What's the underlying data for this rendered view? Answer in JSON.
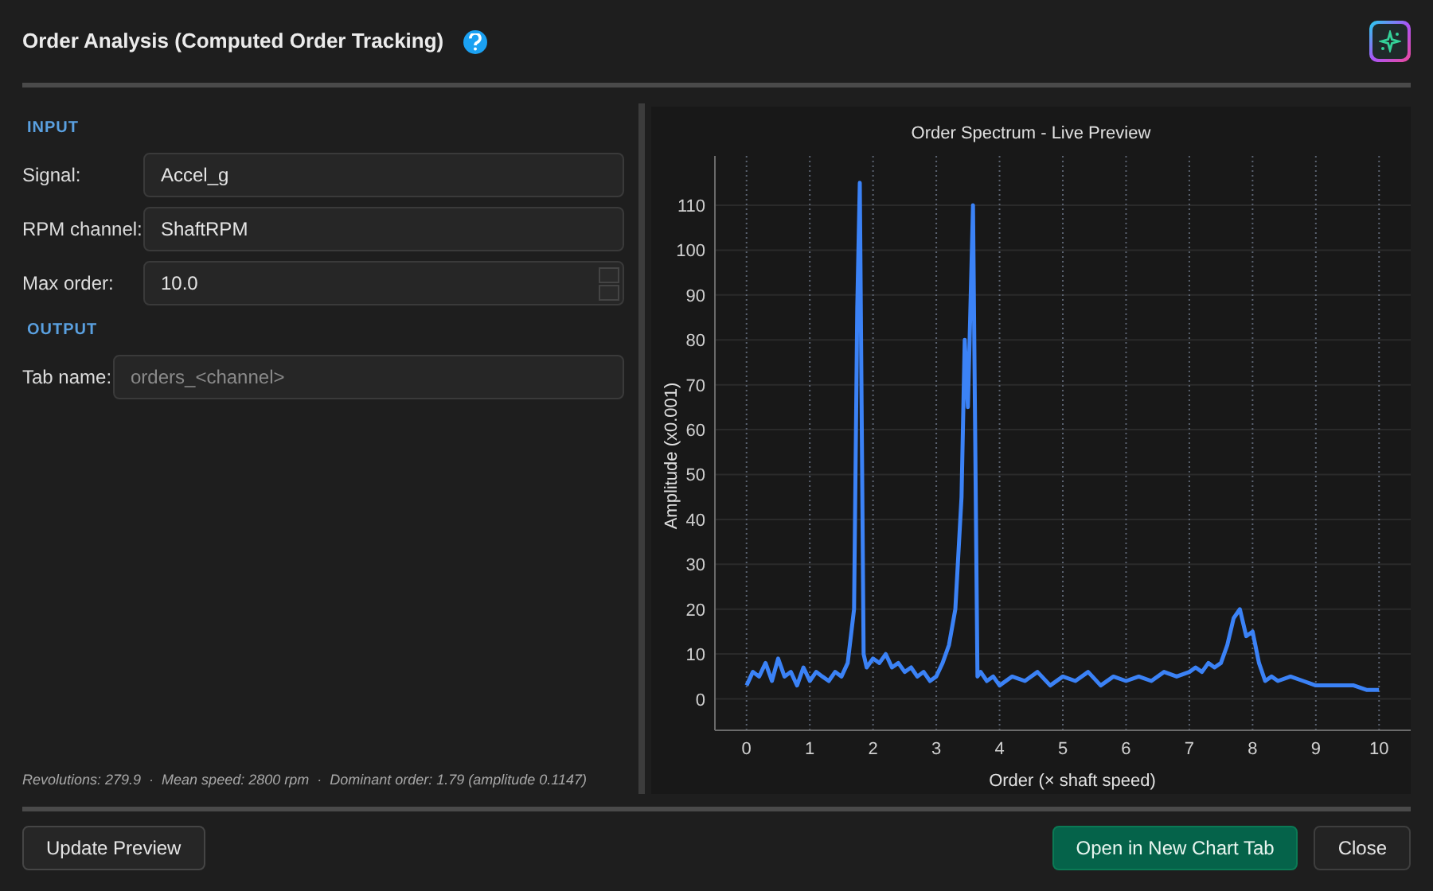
{
  "window": {
    "title": "Order Analysis (Computed Order Tracking)"
  },
  "input": {
    "heading": "INPUT",
    "fields": [
      {
        "label": "Signal:",
        "value": "Accel_g",
        "kind": "combo"
      },
      {
        "label": "RPM channel:",
        "value": "ShaftRPM",
        "kind": "combo"
      },
      {
        "label": "Max order:",
        "value": "10.0",
        "kind": "spin"
      }
    ]
  },
  "output": {
    "heading": "OUTPUT",
    "fields": [
      {
        "label": "Tab name:",
        "placeholder": "orders_<channel>",
        "kind": "text"
      }
    ]
  },
  "summary": "Revolutions: 279.9  ·  Mean speed: 2800 rpm  ·  Dominant order: 1.79 (amplitude 0.1147)",
  "chart": {
    "chart_data": {
      "type": "line",
      "title": "Order Spectrum - Live Preview",
      "xlabel": "Order (× shaft speed)",
      "ylabel": "Amplitude (x0.001)",
      "x": [
        0,
        0.1,
        0.2,
        0.3,
        0.4,
        0.5,
        0.6,
        0.7,
        0.8,
        0.9,
        1.0,
        1.1,
        1.2,
        1.3,
        1.4,
        1.5,
        1.6,
        1.7,
        1.75,
        1.79,
        1.85,
        1.9,
        2.0,
        2.1,
        2.2,
        2.3,
        2.4,
        2.5,
        2.6,
        2.7,
        2.8,
        2.9,
        3.0,
        3.1,
        3.2,
        3.3,
        3.4,
        3.45,
        3.5,
        3.58,
        3.65,
        3.7,
        3.8,
        3.9,
        4.0,
        4.2,
        4.4,
        4.6,
        4.8,
        5.0,
        5.2,
        5.4,
        5.6,
        5.8,
        6.0,
        6.2,
        6.4,
        6.6,
        6.8,
        7.0,
        7.1,
        7.2,
        7.3,
        7.4,
        7.5,
        7.6,
        7.7,
        7.8,
        7.9,
        8.0,
        8.1,
        8.2,
        8.3,
        8.4,
        8.6,
        8.8,
        9.0,
        9.2,
        9.4,
        9.6,
        9.8,
        10.0
      ],
      "series": [
        {
          "color": "#3b82f6",
          "values": [
            3,
            6,
            5,
            8,
            4,
            9,
            5,
            6,
            3,
            7,
            4,
            6,
            5,
            4,
            6,
            5,
            8,
            20,
            87,
            115,
            10,
            7,
            9,
            8,
            10,
            7,
            8,
            6,
            7,
            5,
            6,
            4,
            5,
            8,
            12,
            20,
            45,
            80,
            65,
            110,
            5,
            6,
            4,
            5,
            3,
            5,
            4,
            6,
            3,
            5,
            4,
            6,
            3,
            5,
            4,
            5,
            4,
            6,
            5,
            6,
            7,
            6,
            8,
            7,
            8,
            12,
            18,
            20,
            14,
            15,
            8,
            4,
            5,
            4,
            5,
            4,
            3,
            3,
            3,
            3,
            2,
            2
          ]
        }
      ],
      "grid": true,
      "xlim": [
        -0.5,
        10.5
      ],
      "ylim": [
        -7,
        121
      ],
      "xticks": [
        0,
        1,
        2,
        3,
        4,
        5,
        6,
        7,
        8,
        9,
        10
      ],
      "yticks": [
        0,
        10,
        20,
        30,
        40,
        50,
        60,
        70,
        80,
        90,
        100,
        110
      ]
    }
  },
  "buttons": {
    "update": "Update Preview",
    "open": "Open in New Chart Tab",
    "close": "Close"
  }
}
